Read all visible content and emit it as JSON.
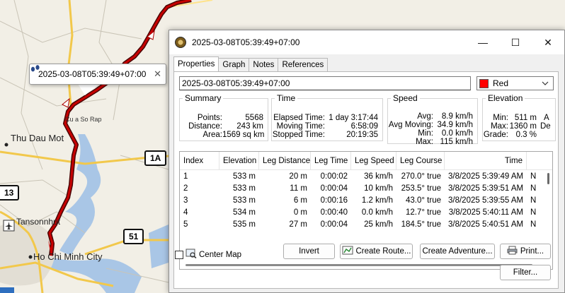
{
  "map": {
    "places": {
      "thu_dau_mot": "Thu Dau Mot",
      "cua_so_rap": "Cu a So Rap",
      "tansonnhut": "Tansonnhut",
      "ho_chi_minh_city": "Ho Chi Minh City"
    },
    "shields": {
      "1a": "1A",
      "13": "13",
      "51": "51"
    },
    "callout": {
      "text": "2025-03-08T05:39:49+07:00",
      "close": "✕",
      "icon": "footprints-icon"
    },
    "colors": {
      "track": "#b40000",
      "road": "#f2c84b",
      "water": "#a9c6e6"
    }
  },
  "window": {
    "title": "2025-03-08T05:39:49+07:00",
    "minimize": "—",
    "maximize": "☐",
    "close": "✕"
  },
  "tabs": [
    "Properties",
    "Graph",
    "Notes",
    "References"
  ],
  "properties": {
    "name_value": "2025-03-08T05:39:49+07:00",
    "color": {
      "label": "Red",
      "hex": "#ff0000"
    },
    "summary": {
      "legend": "Summary",
      "rows": [
        {
          "k": "Points:",
          "v": "5568"
        },
        {
          "k": "Distance:",
          "v": "243 km"
        },
        {
          "k": "Area:",
          "v": "1569 sq km"
        }
      ]
    },
    "time": {
      "legend": "Time",
      "rows": [
        {
          "k": "Elapsed Time:",
          "v": "1 day 3:17:44"
        },
        {
          "k": "Moving Time:",
          "v": "6:58:09"
        },
        {
          "k": "Stopped Time:",
          "v": "20:19:35"
        }
      ]
    },
    "speed": {
      "legend": "Speed",
      "rows": [
        {
          "k": "Avg:",
          "v": "8.9 km/h"
        },
        {
          "k": "Avg Moving:",
          "v": "34.9 km/h"
        },
        {
          "k": "Min:",
          "v": "0.0 km/h"
        },
        {
          "k": "Max:",
          "v": "115 km/h"
        }
      ]
    },
    "elevation": {
      "legend": "Elevation",
      "rows": [
        {
          "k": "Min:",
          "v": "511 m",
          "extra": "A"
        },
        {
          "k": "Max:",
          "v": "1360 m",
          "extra": "De"
        },
        {
          "k": "Grade:",
          "v": "0.3 %",
          "extra": ""
        }
      ]
    }
  },
  "table": {
    "columns": [
      "Index",
      "Elevation",
      "Leg Distance",
      "Leg Time",
      "Leg Speed",
      "Leg Course",
      "Time",
      ""
    ],
    "rows": [
      [
        "1",
        "533 m",
        "20 m",
        "0:00:02",
        "36 km/h",
        "270.0° true",
        "3/8/2025 5:39:49 AM",
        "N"
      ],
      [
        "2",
        "533 m",
        "11 m",
        "0:00:04",
        "10 km/h",
        "253.5° true",
        "3/8/2025 5:39:51 AM",
        "N"
      ],
      [
        "3",
        "533 m",
        "6 m",
        "0:00:16",
        "1.2 km/h",
        "43.0° true",
        "3/8/2025 5:39:55 AM",
        "N"
      ],
      [
        "4",
        "534 m",
        "0 m",
        "0:00:40",
        "0.0 km/h",
        "12.7° true",
        "3/8/2025 5:40:11 AM",
        "N"
      ],
      [
        "5",
        "535 m",
        "27 m",
        "0:00:04",
        "25 km/h",
        "184.5° true",
        "3/8/2025 5:40:51 AM",
        "N"
      ]
    ]
  },
  "footer": {
    "center_map": "Center Map",
    "invert": "Invert",
    "create_route": "Create Route...",
    "create_adventure": "Create Adventure...",
    "print": "Print...",
    "filter": "Filter..."
  }
}
